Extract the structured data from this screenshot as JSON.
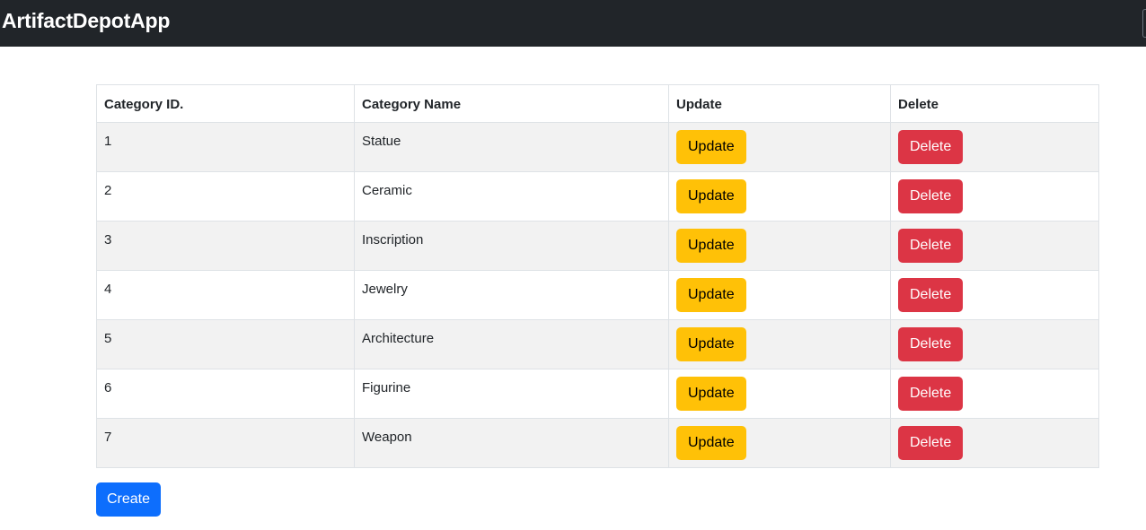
{
  "app": {
    "brand": "ArtifactDepotApp"
  },
  "table": {
    "headers": {
      "id": "Category ID.",
      "name": "Category Name",
      "update": "Update",
      "delete": "Delete"
    },
    "rows": [
      {
        "id": "1",
        "name": "Statue",
        "update_label": "Update",
        "delete_label": "Delete"
      },
      {
        "id": "2",
        "name": "Ceramic",
        "update_label": "Update",
        "delete_label": "Delete"
      },
      {
        "id": "3",
        "name": "Inscription",
        "update_label": "Update",
        "delete_label": "Delete"
      },
      {
        "id": "4",
        "name": "Jewelry",
        "update_label": "Update",
        "delete_label": "Delete"
      },
      {
        "id": "5",
        "name": "Architecture",
        "update_label": "Update",
        "delete_label": "Delete"
      },
      {
        "id": "6",
        "name": "Figurine",
        "update_label": "Update",
        "delete_label": "Delete"
      },
      {
        "id": "7",
        "name": "Weapon",
        "update_label": "Update",
        "delete_label": "Delete"
      }
    ]
  },
  "actions": {
    "create_label": "Create"
  },
  "colors": {
    "navbar": "#212529",
    "update_button": "#ffc107",
    "delete_button": "#dc3545",
    "create_button": "#0d6efd",
    "striped_row": "#f2f2f2"
  }
}
